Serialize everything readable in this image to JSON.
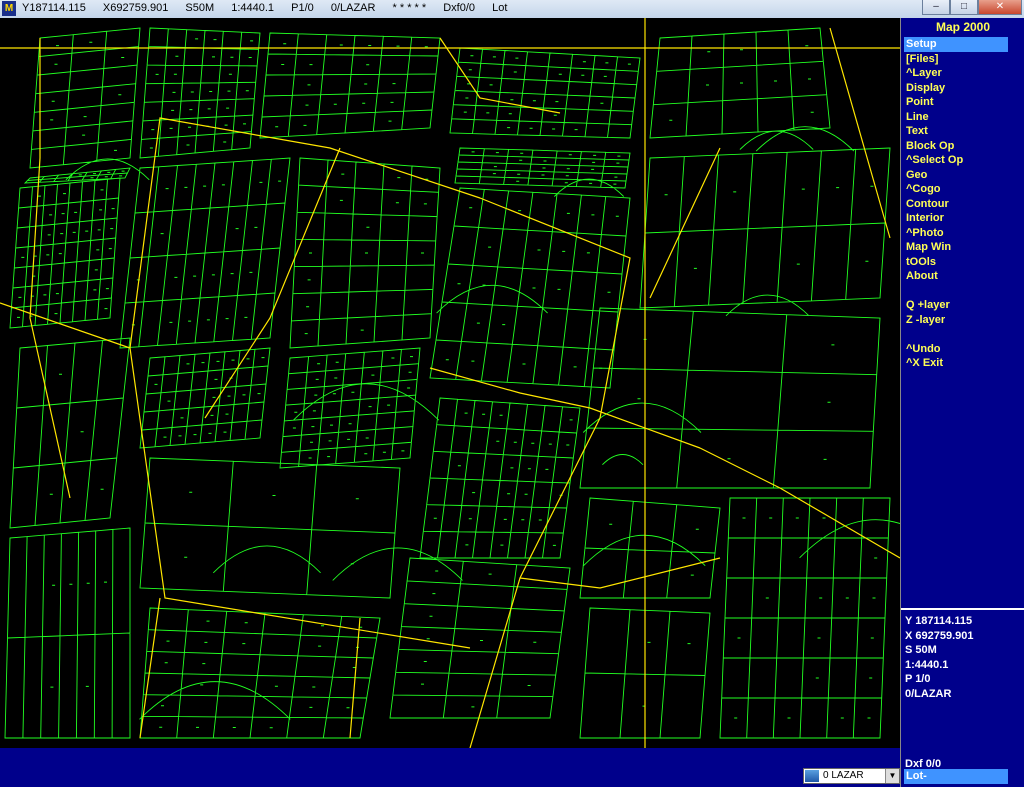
{
  "titlebar": {
    "app_icon": "M",
    "status": {
      "y": "Y187114.115",
      "x": "X692759.901",
      "scale_step": "S50M",
      "ratio": "1:4440.1",
      "page": "P1/0",
      "layer": "0/LAZAR",
      "stars": "* * * * *",
      "dxf": "Dxf0/0",
      "mode": "Lot"
    },
    "window_buttons": {
      "minimize": "–",
      "maximize": "□",
      "close": "✕"
    }
  },
  "panel": {
    "title": "Map 2000",
    "menu": [
      {
        "label": "Setup",
        "active": true
      },
      {
        "label": "[Files]"
      },
      {
        "label": "^Layer"
      },
      {
        "label": "Display"
      },
      {
        "label": "Point"
      },
      {
        "label": "Line"
      },
      {
        "label": "Text"
      },
      {
        "label": "Block Op"
      },
      {
        "label": "^Select Op"
      },
      {
        "label": "Geo"
      },
      {
        "label": "^Cogo"
      },
      {
        "label": "Contour"
      },
      {
        "label": "Interior"
      },
      {
        "label": "^Photo"
      },
      {
        "label": "Map Win"
      },
      {
        "label": "tOOls"
      },
      {
        "label": "About"
      },
      {
        "gap": true
      },
      {
        "label": "Q +layer"
      },
      {
        "label": "Z -layer"
      },
      {
        "gap": true
      },
      {
        "label": "^Undo"
      },
      {
        "label": "^X Exit"
      }
    ],
    "coords": {
      "y": "Y 187114.115",
      "x": "X 692759.901",
      "s": "S 50M",
      "ratio": "1:4440.1",
      "p": "P 1/0",
      "layer": "0/LAZAR"
    },
    "dxf": "Dxf 0/0",
    "lot": "Lot-"
  },
  "bottombar": {
    "layer_select": {
      "value": "0 LAZAR",
      "dropdown_glyph": "▼"
    }
  },
  "colors": {
    "parcel_lines": "#22ff22",
    "boundary_lines": "#ffe600",
    "panel_bg": "#00008b",
    "menu_text": "#ffff55",
    "highlight": "#3f93ff"
  }
}
